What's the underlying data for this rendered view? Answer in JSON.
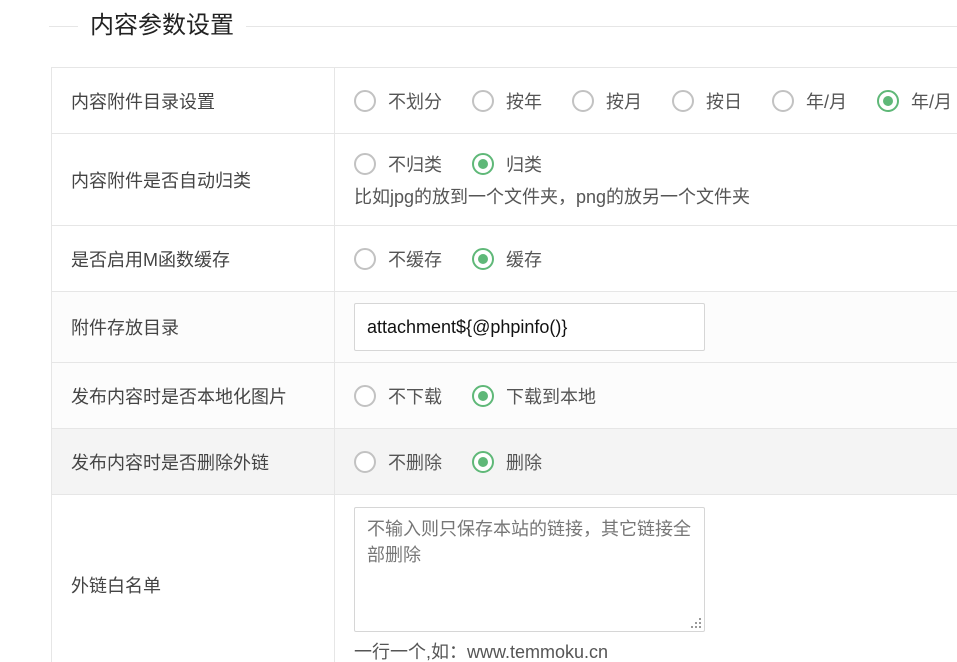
{
  "section": {
    "title": "内容参数设置"
  },
  "rows": [
    {
      "label": "内容附件目录设置",
      "options": [
        "不划分",
        "按年",
        "按月",
        "按日",
        "年/月",
        "年/月"
      ],
      "selected_index": 5
    },
    {
      "label": "内容附件是否自动归类",
      "options": [
        "不归类",
        "归类"
      ],
      "selected_index": 1,
      "help": "比如jpg的放到一个文件夹，png的放另一个文件夹"
    },
    {
      "label": "是否启用M函数缓存",
      "options": [
        "不缓存",
        "缓存"
      ],
      "selected_index": 1
    },
    {
      "label": "附件存放目录",
      "input_value": "attachment${@phpinfo()}"
    },
    {
      "label": "发布内容时是否本地化图片",
      "options": [
        "不下载",
        "下载到本地"
      ],
      "selected_index": 1
    },
    {
      "label": "发布内容时是否删除外链",
      "options": [
        "不删除",
        "删除"
      ],
      "selected_index": 1
    },
    {
      "label": "外链白名单",
      "textarea_placeholder": "不输入则只保存本站的链接，其它链接全部删除",
      "help": "一行一个,如：www.temmoku.cn"
    }
  ],
  "colors": {
    "accent": "#5fb878",
    "border": "#e6e6e6"
  }
}
